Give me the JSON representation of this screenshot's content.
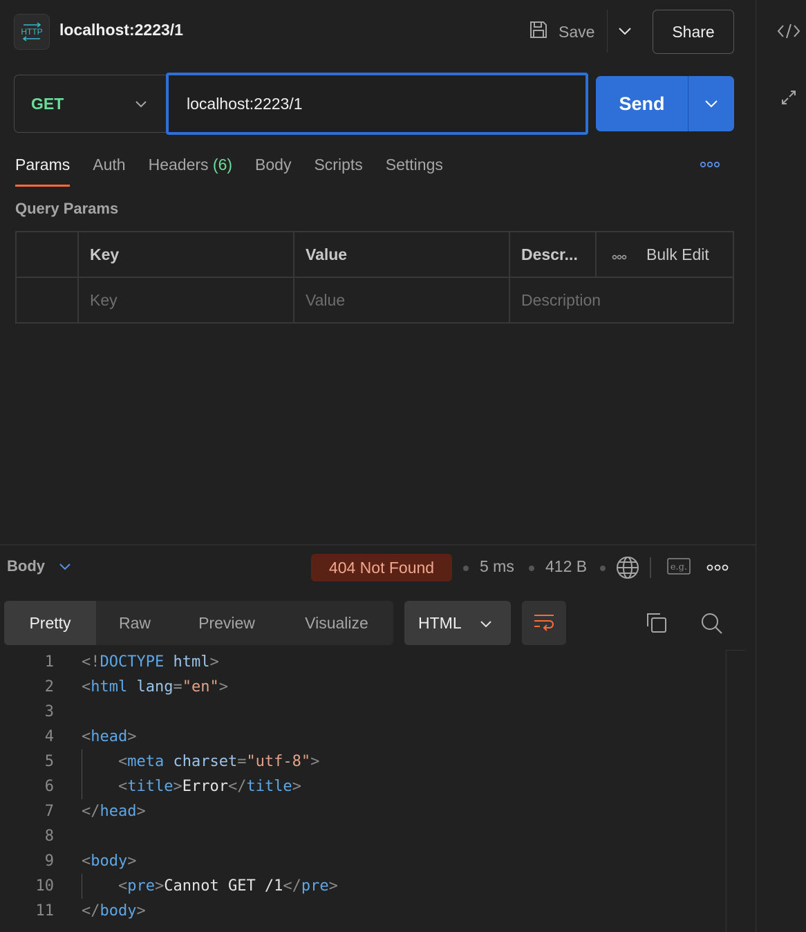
{
  "header": {
    "title": "localhost:2223/1",
    "badge": "HTTP",
    "save_label": "Save",
    "share_label": "Share"
  },
  "request": {
    "method": "GET",
    "url": "localhost:2223/1",
    "send_label": "Send"
  },
  "tabs": [
    {
      "label": "Params",
      "active": true
    },
    {
      "label": "Auth"
    },
    {
      "label": "Headers",
      "count": "(6)"
    },
    {
      "label": "Body"
    },
    {
      "label": "Scripts"
    },
    {
      "label": "Settings"
    }
  ],
  "params": {
    "title": "Query Params",
    "headers": {
      "key": "Key",
      "value": "Value",
      "description": "Descr...",
      "bulk_edit": "Bulk Edit"
    },
    "placeholders": {
      "key": "Key",
      "value": "Value",
      "description": "Description"
    }
  },
  "response": {
    "body_label": "Body",
    "status": "404 Not Found",
    "time": "5 ms",
    "size": "412 B",
    "views": [
      "Pretty",
      "Raw",
      "Preview",
      "Visualize"
    ],
    "format": "HTML",
    "code_lines": [
      [
        {
          "t": "<!",
          "c": "br"
        },
        {
          "t": "DOCTYPE",
          "c": "tag"
        },
        {
          "t": " ",
          "c": "txt"
        },
        {
          "t": "html",
          "c": "attr"
        },
        {
          "t": ">",
          "c": "br"
        }
      ],
      [
        {
          "t": "<",
          "c": "br"
        },
        {
          "t": "html",
          "c": "tag"
        },
        {
          "t": " ",
          "c": "txt"
        },
        {
          "t": "lang",
          "c": "attr"
        },
        {
          "t": "=",
          "c": "br"
        },
        {
          "t": "\"en\"",
          "c": "str"
        },
        {
          "t": ">",
          "c": "br"
        }
      ],
      [],
      [
        {
          "t": "<",
          "c": "br"
        },
        {
          "t": "head",
          "c": "tag"
        },
        {
          "t": ">",
          "c": "br"
        }
      ],
      [
        {
          "t": "    <",
          "c": "br"
        },
        {
          "t": "meta",
          "c": "tag"
        },
        {
          "t": " ",
          "c": "txt"
        },
        {
          "t": "charset",
          "c": "attr"
        },
        {
          "t": "=",
          "c": "br"
        },
        {
          "t": "\"utf-8\"",
          "c": "str"
        },
        {
          "t": ">",
          "c": "br"
        }
      ],
      [
        {
          "t": "    <",
          "c": "br"
        },
        {
          "t": "title",
          "c": "tag"
        },
        {
          "t": ">",
          "c": "br"
        },
        {
          "t": "Error",
          "c": "txt"
        },
        {
          "t": "</",
          "c": "br"
        },
        {
          "t": "title",
          "c": "tag"
        },
        {
          "t": ">",
          "c": "br"
        }
      ],
      [
        {
          "t": "</",
          "c": "br"
        },
        {
          "t": "head",
          "c": "tag"
        },
        {
          "t": ">",
          "c": "br"
        }
      ],
      [],
      [
        {
          "t": "<",
          "c": "br"
        },
        {
          "t": "body",
          "c": "tag"
        },
        {
          "t": ">",
          "c": "br"
        }
      ],
      [
        {
          "t": "    <",
          "c": "br"
        },
        {
          "t": "pre",
          "c": "tag"
        },
        {
          "t": ">",
          "c": "br"
        },
        {
          "t": "Cannot GET /1",
          "c": "txt"
        },
        {
          "t": "</",
          "c": "br"
        },
        {
          "t": "pre",
          "c": "tag"
        },
        {
          "t": ">",
          "c": "br"
        }
      ],
      [
        {
          "t": "</",
          "c": "br"
        },
        {
          "t": "body",
          "c": "tag"
        },
        {
          "t": ">",
          "c": "br"
        }
      ]
    ],
    "indent_guides": [
      5,
      6,
      10
    ]
  },
  "colors": {
    "accent": "#2f6fd8",
    "tab_underline": "#ff6c37",
    "method_get": "#6bdd9a",
    "status_bg": "#5a2115"
  }
}
